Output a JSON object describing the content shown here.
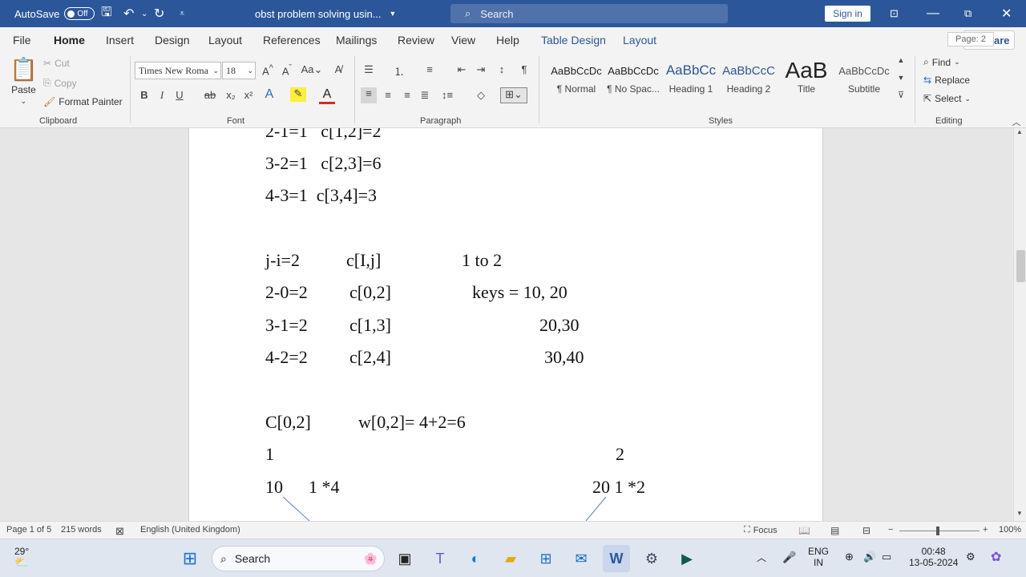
{
  "titlebar": {
    "autosave_label": "AutoSave",
    "autosave_state": "Off",
    "doc_title": "obst problem solving usin...",
    "search_placeholder": "Search",
    "signin": "Sign in"
  },
  "menu": {
    "tabs": [
      "File",
      "Home",
      "Insert",
      "Design",
      "Layout",
      "References",
      "Mailings",
      "Review",
      "View",
      "Help",
      "Table Design",
      "Layout"
    ],
    "active": "Home",
    "share": "Share"
  },
  "ribbon": {
    "clipboard": {
      "paste": "Paste",
      "cut": "Cut",
      "copy": "Copy",
      "format_painter": "Format Painter",
      "label": "Clipboard"
    },
    "font": {
      "name": "Times New Roma",
      "size": "18",
      "label": "Font"
    },
    "paragraph": {
      "label": "Paragraph"
    },
    "styles": {
      "items": [
        {
          "sample": "AaBbCcDc",
          "name": "¶ Normal"
        },
        {
          "sample": "AaBbCcDc",
          "name": "¶ No Spac..."
        },
        {
          "sample": "AaBbCc",
          "name": "Heading 1"
        },
        {
          "sample": "AaBbCcC",
          "name": "Heading 2"
        },
        {
          "sample": "AaB",
          "name": "Title"
        },
        {
          "sample": "AaBbCcDc",
          "name": "Subtitle"
        }
      ],
      "label": "Styles"
    },
    "editing": {
      "find": "Find",
      "replace": "Replace",
      "select": "Select",
      "label": "Editing"
    }
  },
  "document": {
    "lines": [
      {
        "text": "2-1=1   c[1,2]=2"
      },
      {
        "text": "3-2=1   c[2,3]=6"
      },
      {
        "text": "4-3=1  c[3,4]=3"
      },
      {
        "text": "j-i=2"
      },
      {
        "text": "c[I,j]"
      },
      {
        "text": "1 to 2"
      },
      {
        "text": "2-0=2"
      },
      {
        "text": "c[0,2]"
      },
      {
        "text": "keys = 10, 20"
      },
      {
        "text": "3-1=2"
      },
      {
        "text": "c[1,3]"
      },
      {
        "text": "20,30"
      },
      {
        "text": "4-2=2"
      },
      {
        "text": "c[2,4]"
      },
      {
        "text": "30,40"
      },
      {
        "text": "C[0,2]"
      },
      {
        "text": "w[0,2]= 4+2=6"
      },
      {
        "text": "1"
      },
      {
        "text": "2"
      },
      {
        "text": "10"
      },
      {
        "text": "1 *4"
      },
      {
        "text": "20 1 *2"
      }
    ],
    "page_tip": "Page: 2"
  },
  "statusbar": {
    "page": "Page 1 of 5",
    "words": "215 words",
    "language": "English (United Kingdom)",
    "focus": "Focus",
    "zoom": "100%"
  },
  "taskbar": {
    "weather": "29°",
    "search": "Search",
    "lang1": "ENG",
    "lang2": "IN",
    "time": "00:48",
    "date": "13-05-2024"
  }
}
